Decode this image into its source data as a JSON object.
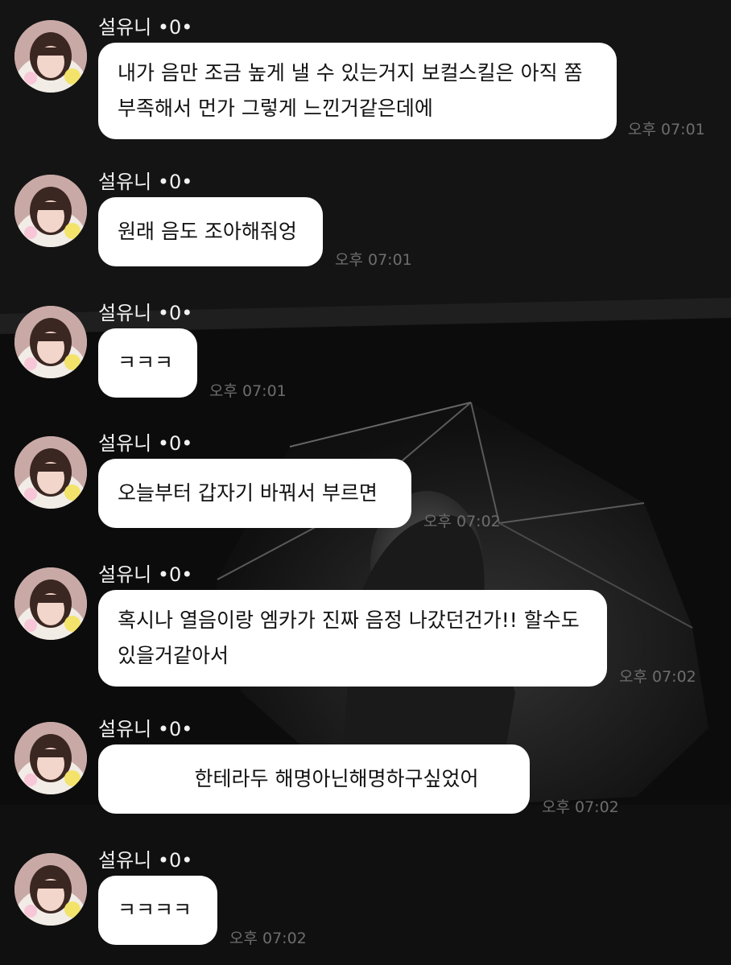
{
  "chat": {
    "messages": [
      {
        "sender": "설유니 •0•",
        "text": "내가 음만 조금 높게 낼 수 있는거지 보컬스킬은 아직 쫌\n부족해서 먼가 그렇게 느낀거같은데에",
        "time": "오후 07:01"
      },
      {
        "sender": "설유니 •0•",
        "text": "원래 음도 조아해줘엉",
        "time": "오후 07:01"
      },
      {
        "sender": "설유니 •0•",
        "text": "ㅋㅋㅋ",
        "time": "오후 07:01"
      },
      {
        "sender": "설유니 •0•",
        "text": "오늘부터 갑자기 바꿔서 부르면",
        "time": "오후 07:02"
      },
      {
        "sender": "설유니 •0•",
        "text": "혹시나 열음이랑 엠카가 진짜 음정 나갔던건가!! 할수도\n있을거같아서",
        "time": "오후 07:02"
      },
      {
        "sender": "설유니 •0•",
        "text": "한테라두 해명아닌해명하구싶었어",
        "time": "오후 07:02"
      },
      {
        "sender": "설유니 •0•",
        "text": "ㅋㅋㅋㅋ",
        "time": "오후 07:02"
      }
    ]
  }
}
